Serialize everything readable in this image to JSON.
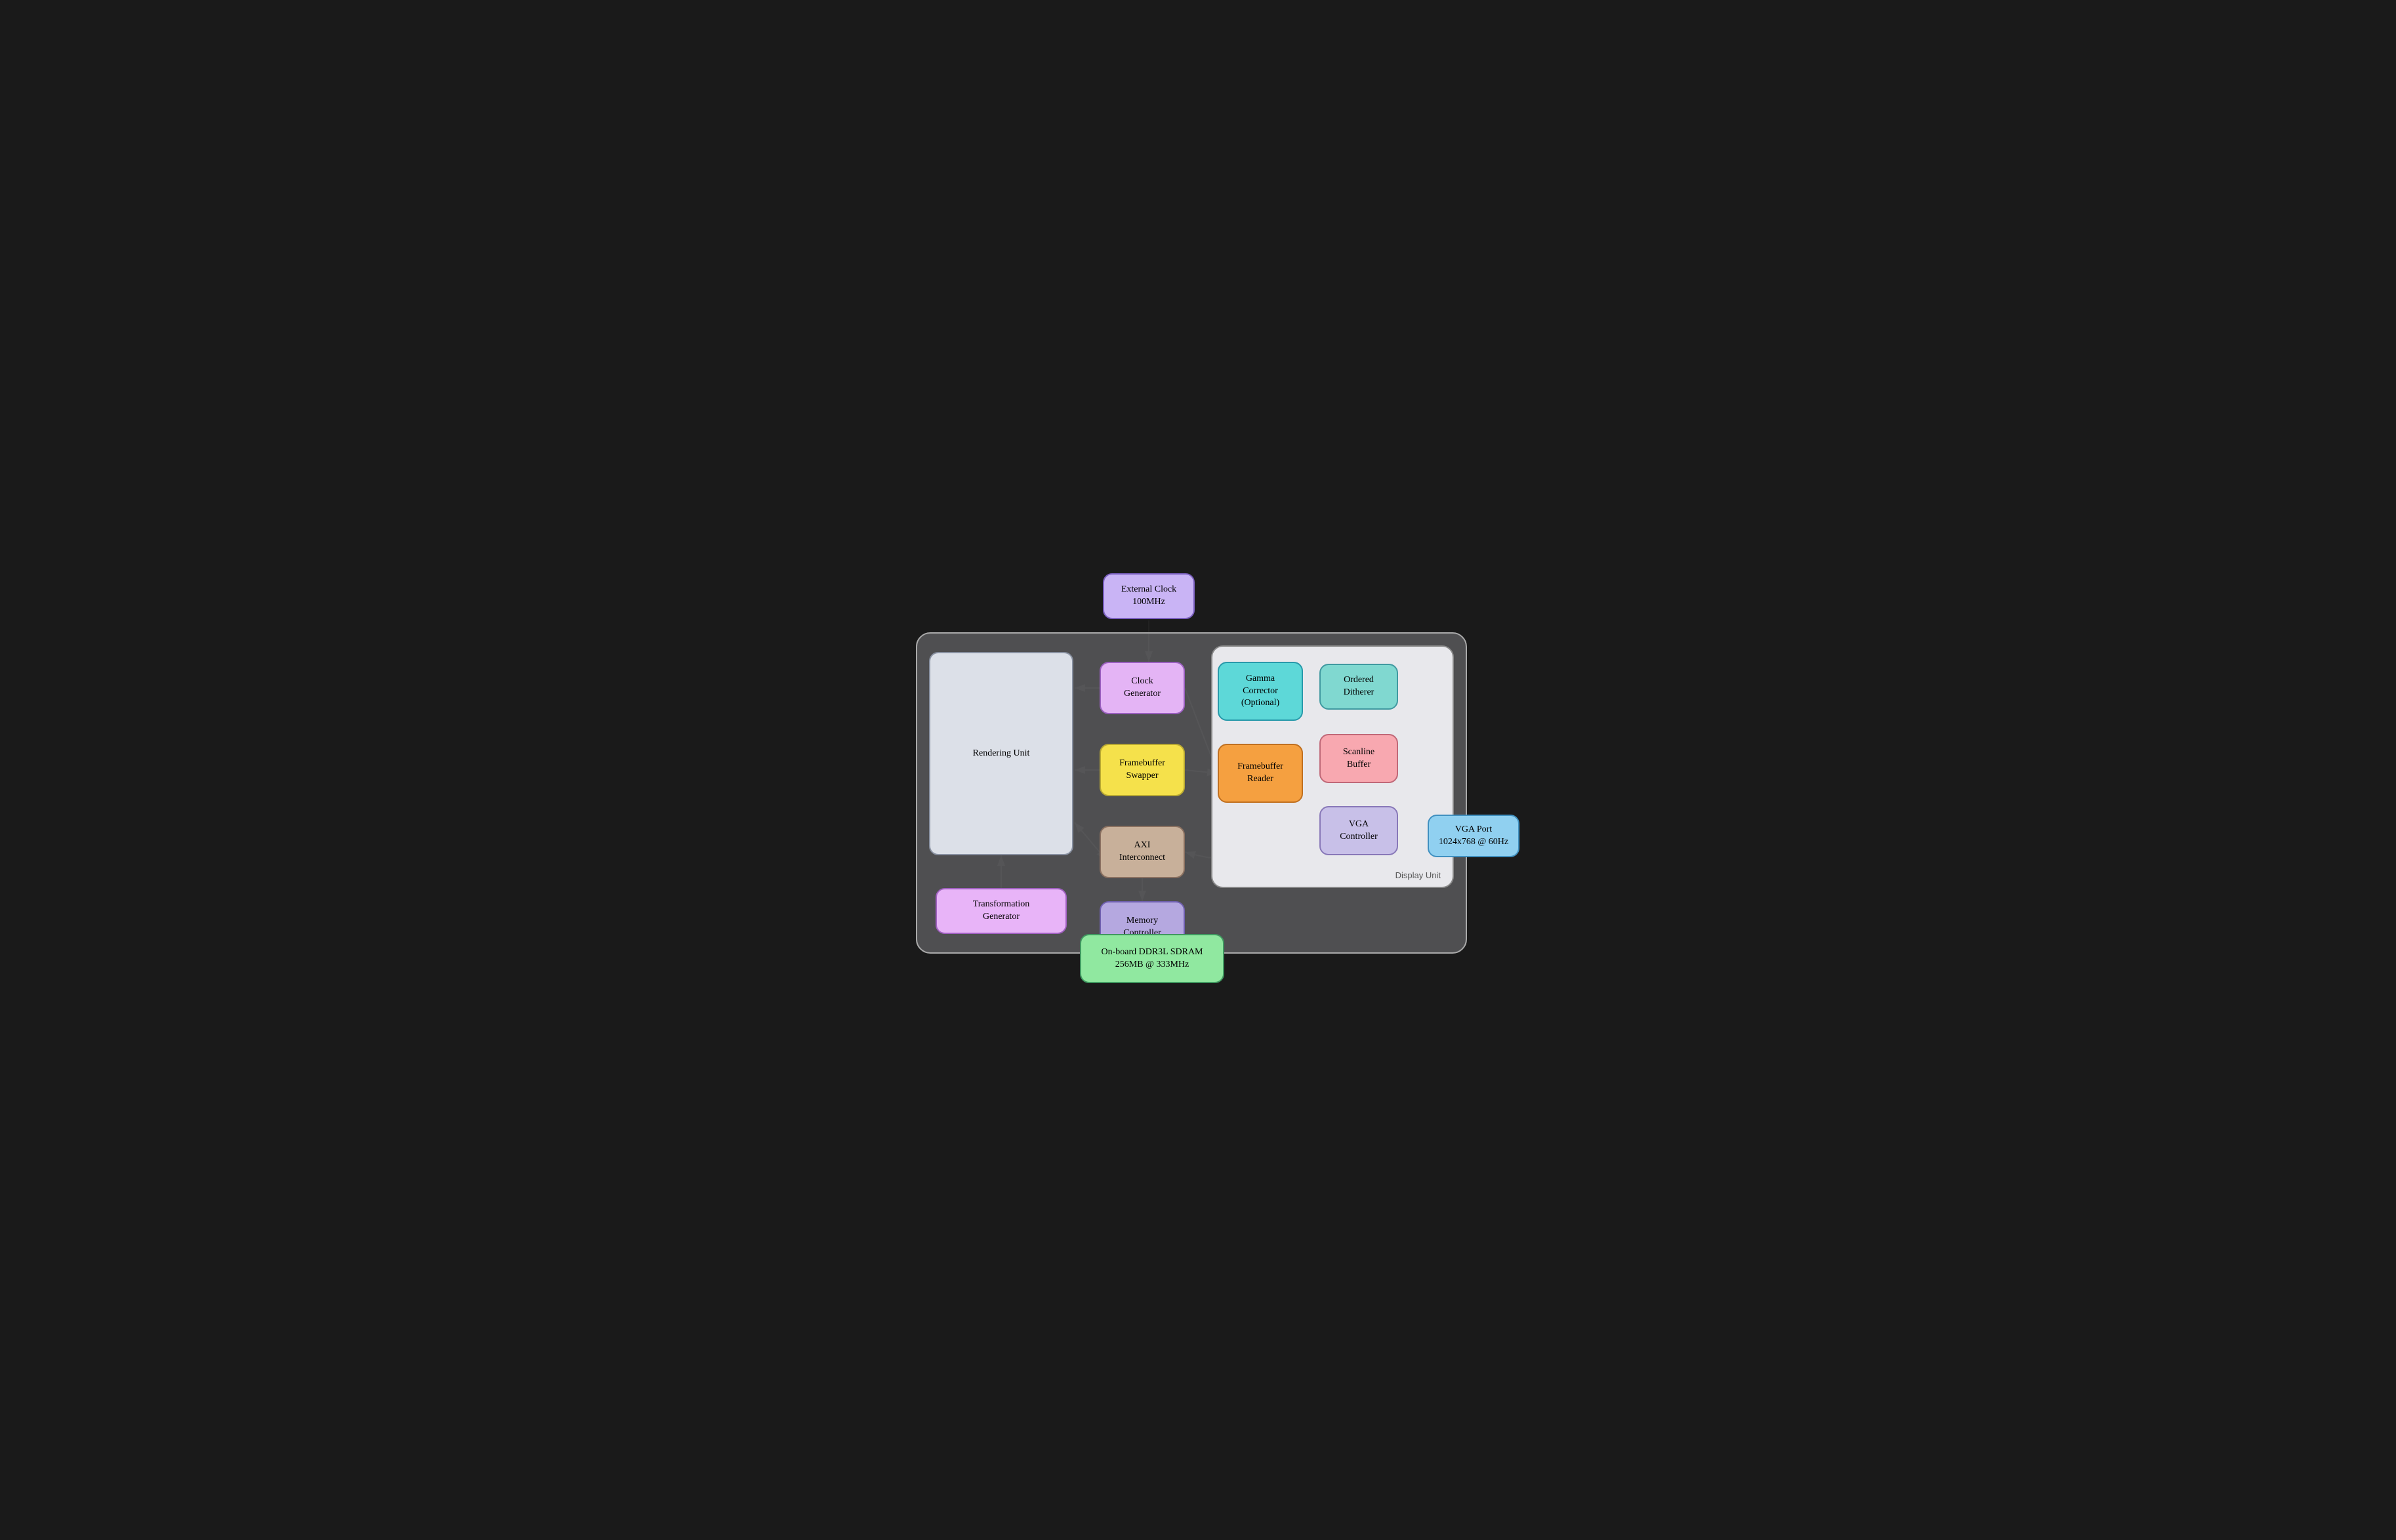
{
  "blocks": {
    "external_clock": {
      "label": "External Clock\n100MHz"
    },
    "clock_generator": {
      "label": "Clock\nGenerator"
    },
    "framebuffer_swapper": {
      "label": "Framebuffer\nSwapper"
    },
    "axi_interconnect": {
      "label": "AXI\nInterconnect"
    },
    "memory_controller": {
      "label": "Memory\nController"
    },
    "rendering_unit": {
      "label": "Rendering Unit"
    },
    "transformation_gen": {
      "label": "Transformation\nGenerator"
    },
    "gamma_corrector": {
      "label": "Gamma\nCorrector\n(Optional)"
    },
    "ordered_ditherer": {
      "label": "Ordered\nDitherer"
    },
    "framebuffer_reader": {
      "label": "Framebuffer\nReader"
    },
    "scanline_buffer": {
      "label": "Scanline\nBuffer"
    },
    "vga_controller": {
      "label": "VGA\nController"
    },
    "vga_port": {
      "label": "VGA Port\n1024x768 @ 60Hz"
    },
    "ddr3_sdram": {
      "label": "On-board DDR3L SDRAM\n256MB @ 333MHz"
    },
    "display_unit": {
      "label": "Display Unit"
    }
  }
}
